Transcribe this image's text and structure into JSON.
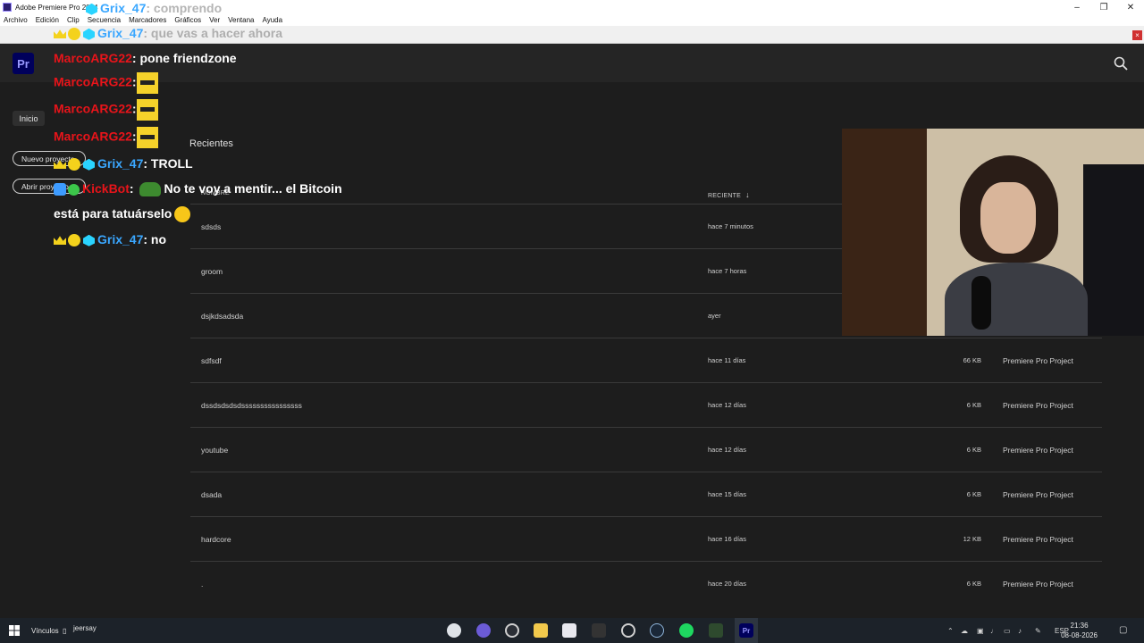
{
  "window": {
    "title": "Adobe Premiere Pro 2024",
    "controls": [
      "–",
      "❐",
      "✕"
    ]
  },
  "menu": [
    "Archivo",
    "Edición",
    "Clip",
    "Secuencia",
    "Marcadores",
    "Gráficos",
    "Ver",
    "Ventana",
    "Ayuda"
  ],
  "app": {
    "logo": "Pr"
  },
  "nav": {
    "home": "Inicio",
    "new_project": "Nuevo proyecto",
    "open_project": "Abrir proyecto"
  },
  "recent": {
    "heading": "Recientes",
    "col_name": "NOMBRE",
    "col_recent": "RECIENTE",
    "rows": [
      {
        "name": "sdsds",
        "date": "hace 7 minutos",
        "size": "",
        "type": ""
      },
      {
        "name": "groom",
        "date": "hace 7 horas",
        "size": "",
        "type": ""
      },
      {
        "name": "dsjkdsadsda",
        "date": "ayer",
        "size": "",
        "type": ""
      },
      {
        "name": "sdfsdf",
        "date": "hace 11 días",
        "size": "66 KB",
        "type": "Premiere Pro Project"
      },
      {
        "name": "dssdsdsdsdssssssssssssssss",
        "date": "hace 12 días",
        "size": "6 KB",
        "type": "Premiere Pro Project"
      },
      {
        "name": "youtube",
        "date": "hace 12 días",
        "size": "6 KB",
        "type": "Premiere Pro Project"
      },
      {
        "name": "dsada",
        "date": "hace 15 días",
        "size": "6 KB",
        "type": "Premiere Pro Project"
      },
      {
        "name": "hardcore",
        "date": "hace 16 días",
        "size": "12 KB",
        "type": "Premiere Pro Project"
      },
      {
        "name": ".",
        "date": "hace 20 días",
        "size": "6 KB",
        "type": "Premiere Pro Project"
      }
    ]
  },
  "chat": {
    "ghost1_user": "Grix_47",
    "ghost1_msg": ": comprendo",
    "ghost2_user": "Grix_47",
    "ghost2_msg": ": que vas a hacer ahora",
    "lines": [
      {
        "user": "MarcoARG22",
        "msg": ": pone friendzone"
      },
      {
        "user": "MarcoARG22",
        "msg": ":"
      },
      {
        "user": "MarcoARG22",
        "msg": ":"
      },
      {
        "user": "MarcoARG22",
        "msg": ":"
      },
      {
        "user": "Grix_47",
        "msg": ": TROLL"
      },
      {
        "user": "KickBot",
        "msg": ": "
      },
      {
        "user": "Grix_47",
        "msg": ": no"
      }
    ],
    "kickbot_text": "No te voy a mentir... el Bitcoin",
    "kickbot_text2": "está para tatuárselo"
  },
  "taskbar": {
    "links": "Vínculos",
    "user": "jeersay",
    "lang": "ESP",
    "time": "21:36",
    "date": "08-08-2026"
  },
  "colors": {
    "accent_red": "#e8141a",
    "accent_blue": "#3aa7ff",
    "premiere_purple": "#9999ff"
  }
}
